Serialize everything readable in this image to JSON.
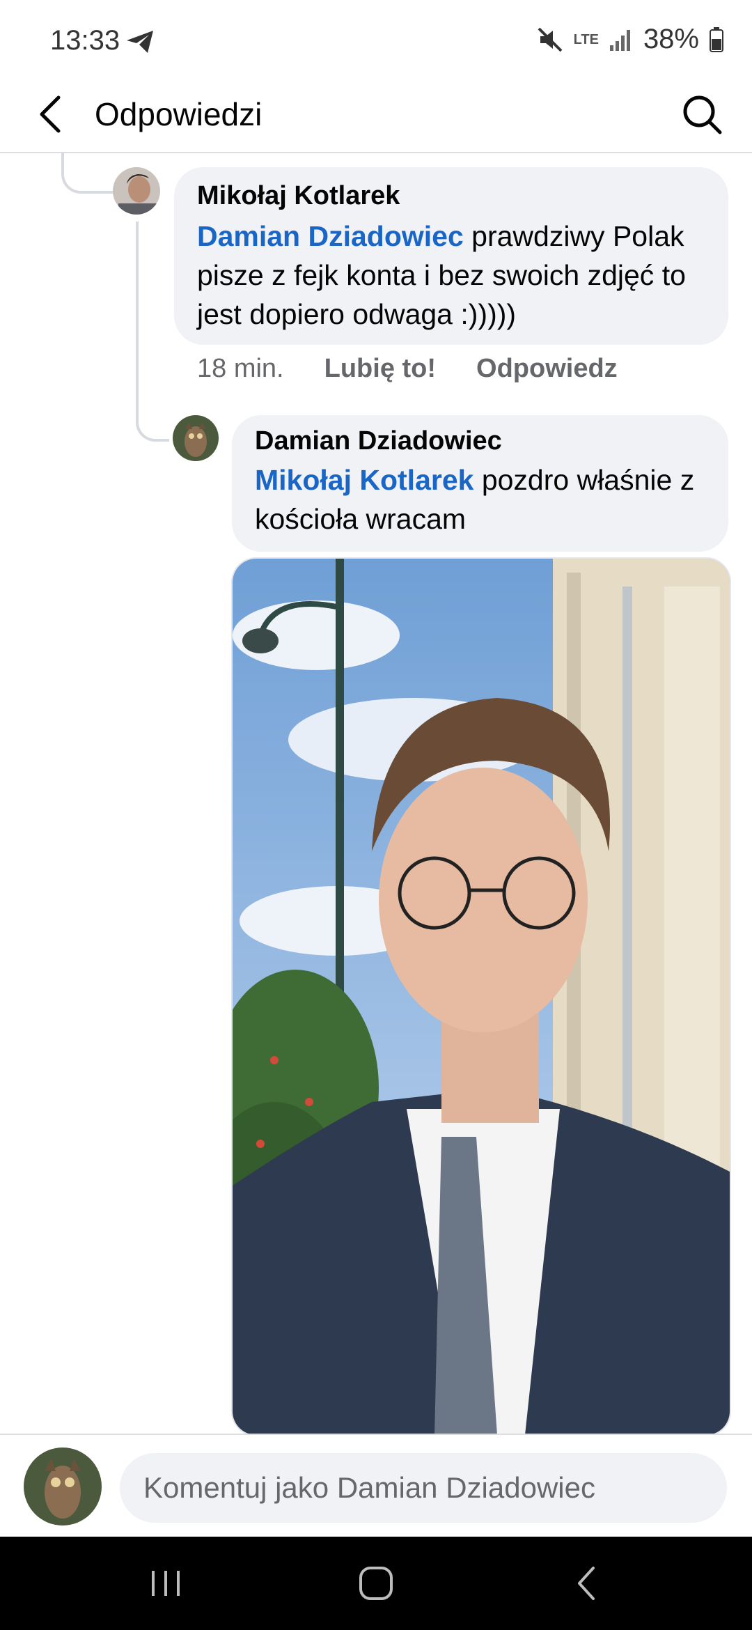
{
  "status_bar": {
    "time": "13:33",
    "network": "LTE",
    "battery": "38%",
    "icons": [
      "telegram-send-icon",
      "mute-icon",
      "signal-icon",
      "battery-icon"
    ]
  },
  "header": {
    "title": "Odpowiedzi",
    "icons": [
      "back-arrow-icon",
      "search-icon"
    ]
  },
  "comments": [
    {
      "author": "Mikołaj Kotlarek",
      "mention": "Damian Dziadowiec",
      "text": " prawdziwy Polak pisze z fejk konta i bez swoich zdjęć to jest dopiero odwaga :)))))",
      "time": "18 min.",
      "like_label": "Lubię to!",
      "reply_label": "Odpowiedz"
    },
    {
      "author": "Damian Dziadowiec",
      "mention": "Mikołaj Kotlarek",
      "text": " pozdro właśnie z kościoła wracam",
      "has_photo": true
    }
  ],
  "composer": {
    "placeholder": "Komentuj jako Damian Dziadowiec"
  },
  "nav_bar": {
    "icons": [
      "recent-apps-icon",
      "home-icon",
      "back-icon"
    ]
  },
  "colors": {
    "mention": "#1a66c6",
    "bubble": "#f0f2f5",
    "meta": "#65676b"
  }
}
